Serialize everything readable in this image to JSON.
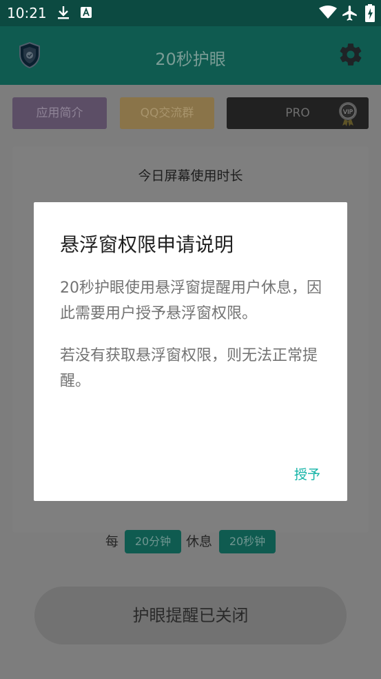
{
  "status_bar": {
    "time": "10:21"
  },
  "app_bar": {
    "title": "20秒护眼"
  },
  "top_buttons": {
    "intro": "应用简介",
    "qq_group": "QQ交流群",
    "pro": "PRO",
    "vip_badge": "VIP"
  },
  "card": {
    "title": "今日屏幕使用时长"
  },
  "interval": {
    "every": "每",
    "work_value": "20分钟",
    "rest": "休息",
    "rest_value": "20秒钟"
  },
  "toggle": {
    "label": "护眼提醒已关闭"
  },
  "dialog": {
    "title": "悬浮窗权限申请说明",
    "body1": "20秒护眼使用悬浮窗提醒用户休息，因此需要用户授予悬浮窗权限。",
    "body2": "若没有获取悬浮窗权限，则无法正常提醒。",
    "confirm": "授予"
  },
  "colors": {
    "primary": "#0f5b50",
    "accent": "#12b3a6",
    "scrim": "#7d7d7d"
  }
}
